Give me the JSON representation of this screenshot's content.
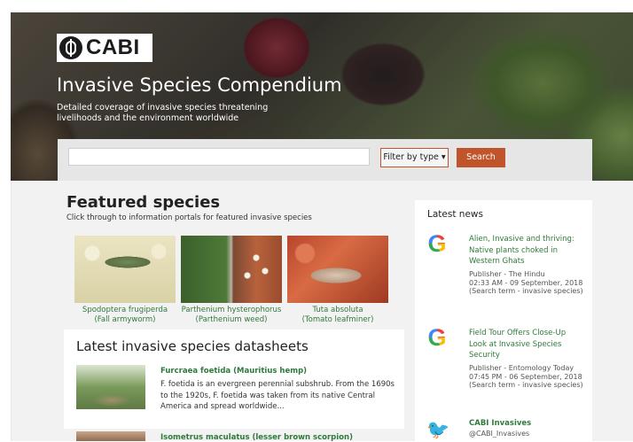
{
  "brand": {
    "logo_text": "CABI"
  },
  "hero": {
    "title": "Invasive Species Compendium",
    "tagline": "Detailed coverage of invasive species threatening livelihoods and the environment worldwide"
  },
  "search": {
    "input_value": "",
    "filter_label": "Filter by type ▾",
    "search_label": "Search"
  },
  "featured": {
    "title": "Featured species",
    "subtitle": "Click through to information portals for featured invasive species",
    "items": [
      {
        "line1": "Spodoptera frugiperda",
        "line2": "(Fall armyworm)"
      },
      {
        "line1": "Parthenium hysterophorus",
        "line2": "(Parthenium weed)"
      },
      {
        "line1": "Tuta absoluta",
        "line2": "(Tomato leafminer)"
      }
    ]
  },
  "datasheets": {
    "title": "Latest invasive species datasheets",
    "items": [
      {
        "name": "Furcraea foetida (Mauritius hemp)",
        "desc": "F. foetida is an evergreen perennial subshrub. From the 1690s to the 1920s, F. foetida was taken from its native Central America and spread worldwide..."
      },
      {
        "name": "Isometrus maculatus (lesser brown scorpion)",
        "desc": ""
      }
    ]
  },
  "news": {
    "title": "Latest news",
    "items": [
      {
        "icon": "google-icon",
        "headline": "Alien, Invasive and thriving: Native plants choked in Western Ghats",
        "meta": "Publisher - The Hindu\n02:33 AM - 09 September, 2018\n(Search term - invasive species)"
      },
      {
        "icon": "google-icon",
        "headline": "Field Tour Offers Close-Up Look at Invasive Species Security",
        "meta": "Publisher - Entomology Today\n07:45 PM - 06 September, 2018\n(Search term - invasive species)"
      }
    ],
    "tweet": {
      "icon": "twitter-icon",
      "name": "CABI Invasives",
      "handle": "@CABI_Invasives"
    }
  },
  "colors": {
    "accent": "#c0552b",
    "link": "#2f7a3b",
    "text": "#222222"
  }
}
